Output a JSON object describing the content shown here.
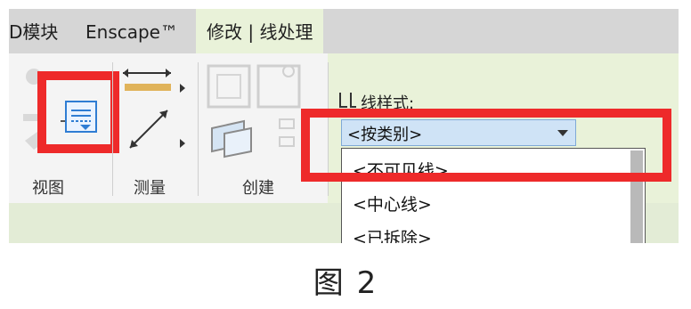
{
  "tabs": [
    "D模块",
    "Enscape™",
    "修改 | 线处理"
  ],
  "groups": {
    "view": "视图",
    "measure": "测量",
    "create": "创建"
  },
  "properties": {
    "line_style_label": "线样式:",
    "combo_value": "<按类别>",
    "dropdown_items": [
      "<不可见线>",
      "<中心线>",
      "<已拆除>"
    ]
  },
  "caption": "图 2",
  "colors": {
    "highlight_red": "#ee2a2a",
    "context_tab": "#e9f2d9",
    "combo_bg": "#cfe3f6"
  }
}
